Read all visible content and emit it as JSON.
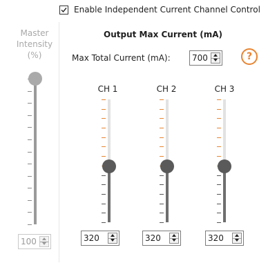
{
  "enable_independent": {
    "label": "Enable Independent Current Channel Control",
    "checked": true
  },
  "master": {
    "title_lines": [
      "Master",
      "Intensity",
      "(%)"
    ],
    "slider_fraction": 1.0,
    "value": "100",
    "enabled": false
  },
  "output": {
    "title": "Output Max Current (mA)",
    "max_total_label": "Max Total Current (mA):",
    "max_total_value": "700",
    "help_symbol": "?"
  },
  "channels": [
    {
      "label": "CH 1",
      "value": "320",
      "slider_fraction": 0.457
    },
    {
      "label": "CH 2",
      "value": "320",
      "slider_fraction": 0.457
    },
    {
      "label": "CH 3",
      "value": "320",
      "slider_fraction": 0.457
    }
  ],
  "colors": {
    "accent_orange": "#e8842f",
    "track_light": "#e2e2e2",
    "track_dark": "#6e6e6e",
    "thumb_active": "#5a5a5a",
    "thumb_disabled": "#aaaaaa"
  }
}
